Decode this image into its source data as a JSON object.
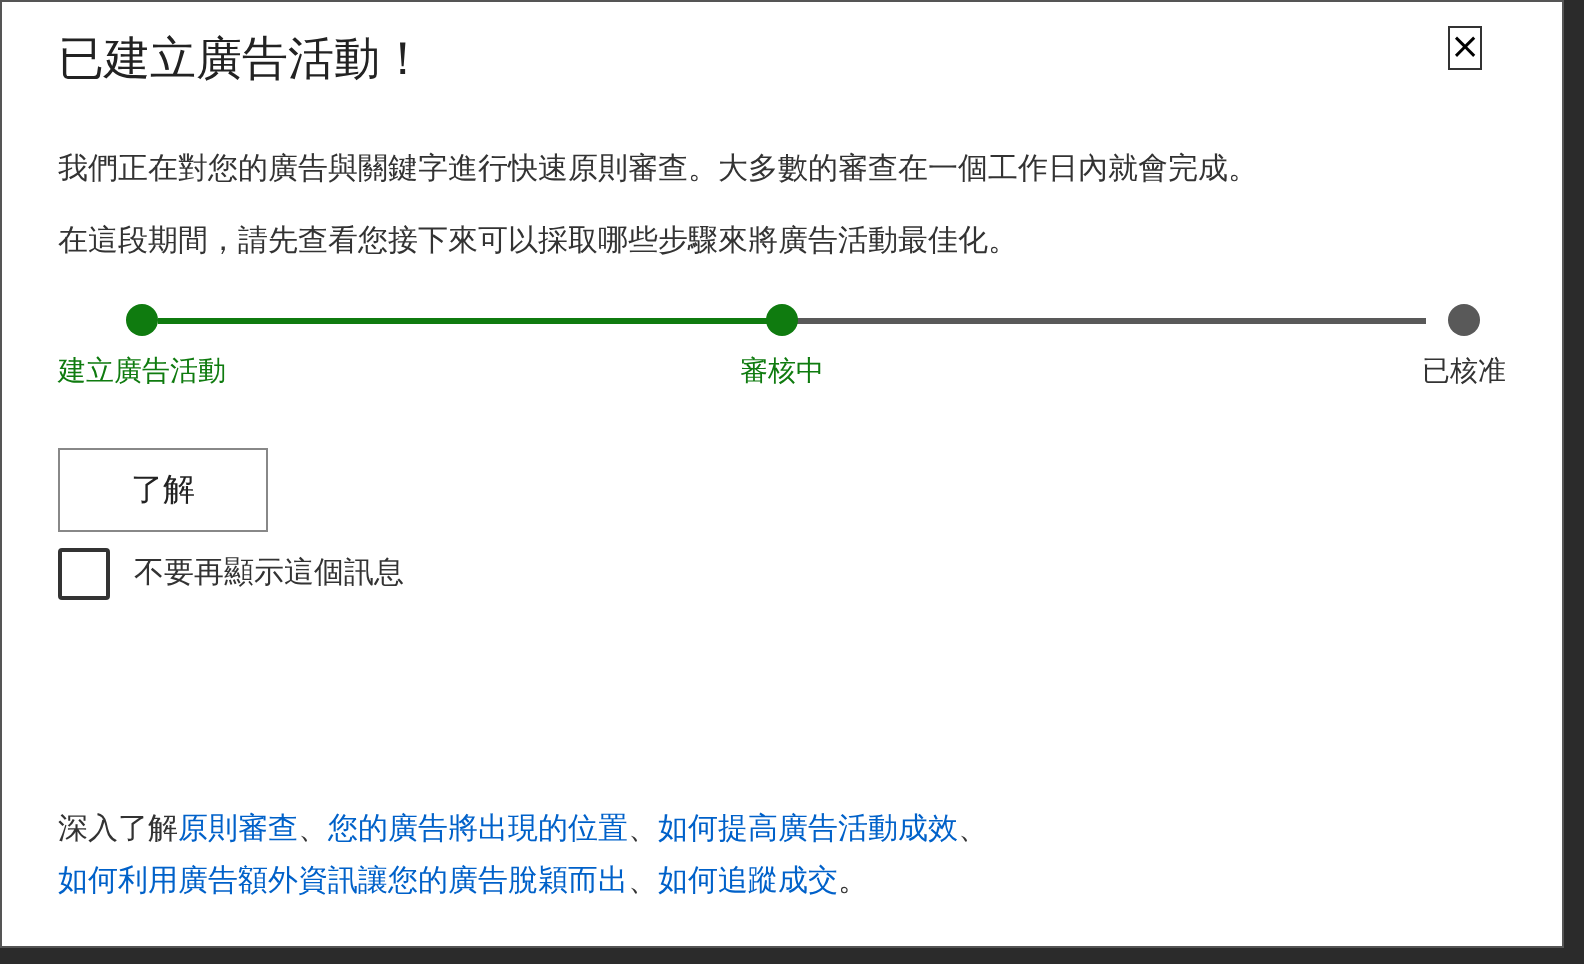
{
  "dialog": {
    "title": "已建立廣告活動！",
    "close": "×",
    "paragraphs": [
      "我們正在對您的廣告與關鍵字進行快速原則審查。大多數的審查在一個工作日內就會完成。",
      "在這段期間，請先查看您接下來可以採取哪些步驟來將廣告活動最佳化。"
    ],
    "steps": [
      {
        "label": "建立廣告活動",
        "completed": true
      },
      {
        "label": "審核中",
        "completed": true
      },
      {
        "label": "已核准",
        "completed": false
      }
    ],
    "ok_button": "了解",
    "dont_show": {
      "label": "不要再顯示這個訊息",
      "checked": false
    },
    "footer": [
      {
        "kind": "text",
        "text": "深入了解"
      },
      {
        "kind": "link",
        "text": "原則審查"
      },
      {
        "kind": "text",
        "text": "、"
      },
      {
        "kind": "link",
        "text": "您的廣告將出現的位置"
      },
      {
        "kind": "text",
        "text": "、"
      },
      {
        "kind": "link",
        "text": "如何提高廣告活動成效"
      },
      {
        "kind": "text",
        "text": "、"
      },
      {
        "kind": "link",
        "text": "如何利用廣告額外資訊讓您的廣告脫穎而出"
      },
      {
        "kind": "text",
        "text": "、"
      },
      {
        "kind": "link",
        "text": "如何追蹤成交"
      },
      {
        "kind": "text",
        "text": "。"
      }
    ]
  }
}
